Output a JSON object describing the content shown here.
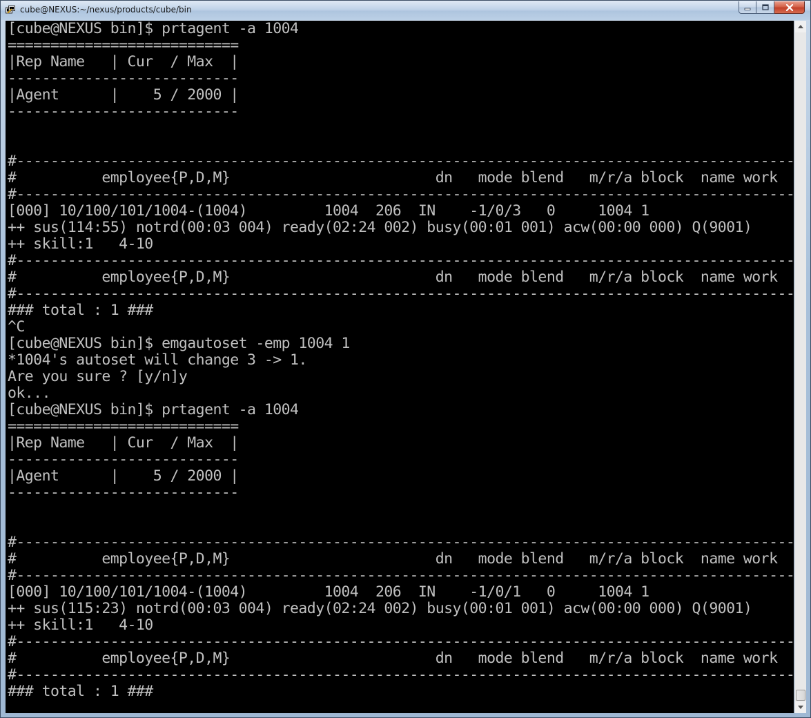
{
  "window": {
    "title": "cube@NEXUS:~/nexus/products/cube/bin",
    "icon": "putty-terminal-icon",
    "buttons": {
      "minimize_icon": "minimize-icon",
      "maximize_icon": "maximize-icon",
      "close_icon": "close-icon"
    }
  },
  "colors": {
    "terminal_bg": "#000000",
    "terminal_fg": "#c0c0c0",
    "close_button": "#c9432c"
  },
  "terminal": {
    "lines": [
      "[cube@NEXUS bin]$ prtagent -a 1004",
      "===========================",
      "|Rep Name   | Cur  / Max  |",
      "---------------------------",
      "|Agent      |    5 / 2000 |",
      "---------------------------",
      "",
      "",
      "#-------------------------------------------------------------------------------------------#",
      "#          employee{P,D,M}                        dn   mode blend   m/r/a block  name work",
      "#-------------------------------------------------------------------------------------------#",
      "[000] 10/100/101/1004-(1004)         1004  206  IN    -1/0/3   0     1004 1",
      "++ sus(114:55) notrd(00:03 004) ready(02:24 002) busy(00:01 001) acw(00:00 000) Q(9001)",
      "++ skill:1   4-10",
      "#-------------------------------------------------------------------------------------------#",
      "#          employee{P,D,M}                        dn   mode blend   m/r/a block  name work",
      "#-------------------------------------------------------------------------------------------#",
      "### total : 1 ###",
      "^C",
      "[cube@NEXUS bin]$ emgautoset -emp 1004 1",
      "*1004's autoset will change 3 -> 1.",
      "Are you sure ? [y/n]y",
      "ok...",
      "[cube@NEXUS bin]$ prtagent -a 1004",
      "===========================",
      "|Rep Name   | Cur  / Max  |",
      "---------------------------",
      "|Agent      |    5 / 2000 |",
      "---------------------------",
      "",
      "",
      "#-------------------------------------------------------------------------------------------#",
      "#          employee{P,D,M}                        dn   mode blend   m/r/a block  name work",
      "#-------------------------------------------------------------------------------------------#",
      "[000] 10/100/101/1004-(1004)         1004  206  IN    -1/0/1   0     1004 1",
      "++ sus(115:23) notrd(00:03 004) ready(02:24 002) busy(00:01 001) acw(00:00 000) Q(9001)",
      "++ skill:1   4-10",
      "#-------------------------------------------------------------------------------------------#",
      "#          employee{P,D,M}                        dn   mode blend   m/r/a block  name work",
      "#-------------------------------------------------------------------------------------------#",
      "### total : 1 ###"
    ]
  },
  "scrollbar": {
    "up_icon": "scroll-up-arrow-icon",
    "down_icon": "scroll-down-arrow-icon",
    "position": 1.0
  }
}
